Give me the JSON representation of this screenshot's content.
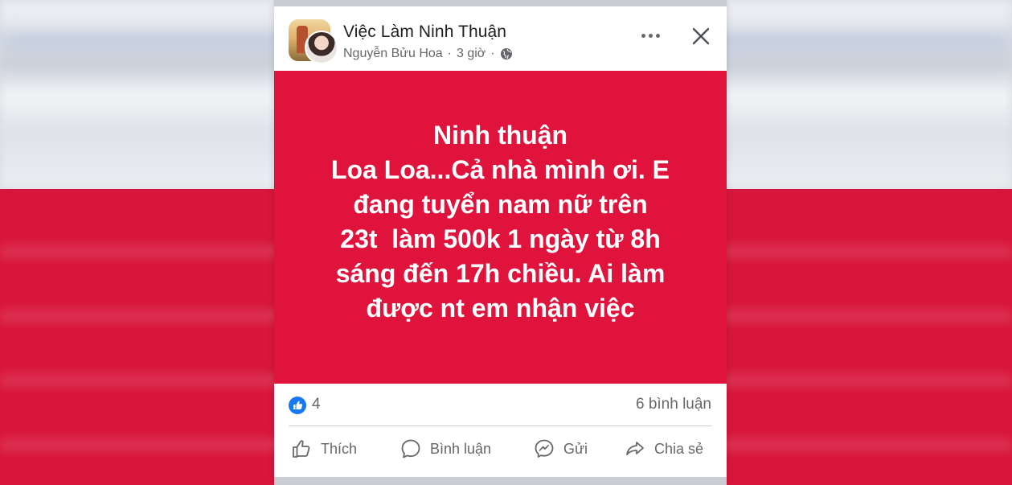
{
  "post": {
    "page_name": "Việc Làm Ninh Thuận",
    "author": "Nguyễn Bửu Hoa",
    "separator": "·",
    "time": "3 giờ",
    "privacy_icon": "globe-icon",
    "text_lines": [
      "Ninh thuận",
      "Loa Loa...Cả nhà mình ơi. E",
      "đang tuyển nam nữ trên",
      "23t  làm 500k 1 ngày từ 8h",
      "sáng đến 17h chiều. Ai làm",
      "được nt em nhận việc"
    ],
    "background_color": "#df133b"
  },
  "stats": {
    "reaction_icon": "like-icon",
    "reaction_count": "4",
    "comments": "6 bình luận"
  },
  "actions": {
    "like": "Thích",
    "comment": "Bình luận",
    "send": "Gửi",
    "share": "Chia sẻ"
  },
  "colors": {
    "accent": "#1877f2",
    "text_secondary": "#65676b",
    "post_red": "#df133b"
  }
}
